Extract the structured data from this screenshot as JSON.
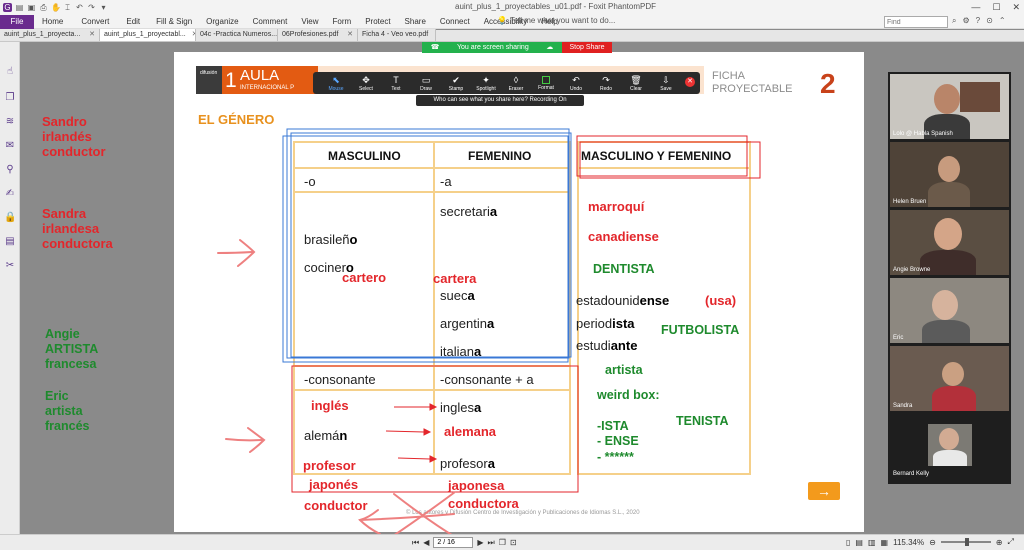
{
  "window": {
    "title": "auint_plus_1_proyectables_u01.pdf - Foxit PhantomPDF",
    "controls": [
      "—",
      "☐",
      "✕"
    ]
  },
  "menu": {
    "file": "File",
    "items": [
      "Home",
      "Convert",
      "Edit",
      "Fill & Sign",
      "Organize",
      "Comment",
      "View",
      "Form",
      "Protect",
      "Share",
      "Connect",
      "Accessibility",
      "Help"
    ],
    "tell_me": "Tell me what you want to do...",
    "find_placeholder": "Find"
  },
  "tabs": [
    {
      "label": "auint_plus_1_proyecta...",
      "active": false
    },
    {
      "label": "auint_plus_1_proyectabl...",
      "active": true
    },
    {
      "label": "04c -Practica Numeros...",
      "active": false
    },
    {
      "label": "06Profesiones.pdf",
      "active": false
    },
    {
      "label": "Ficha 4 - Veo veo.pdf",
      "active": false
    }
  ],
  "zoom": {
    "sharing": "You are screen sharing",
    "stop_share": "Stop Share",
    "tools": [
      {
        "icon": "⬉",
        "label": "Mouse"
      },
      {
        "icon": "✥",
        "label": "Select"
      },
      {
        "icon": "T",
        "label": "Text"
      },
      {
        "icon": "▭",
        "label": "Draw"
      },
      {
        "icon": "✔",
        "label": "Stamp"
      },
      {
        "icon": "✦",
        "label": "Spotlight"
      },
      {
        "icon": "◊",
        "label": "Eraser"
      },
      {
        "icon": "■",
        "label": "Format"
      },
      {
        "icon": "↶",
        "label": "Undo"
      },
      {
        "icon": "↷",
        "label": "Redo"
      },
      {
        "icon": "🗑",
        "label": "Clear"
      },
      {
        "icon": "⇩",
        "label": "Save"
      }
    ],
    "recording": "Who can see what you share here? Recording On"
  },
  "page": {
    "logo_number": "1",
    "logo_title": "AULA",
    "logo_subtitle": "INTERNACIONAL P",
    "logo_small": "difusión",
    "ficha_line1": "FICHA",
    "ficha_line2": "PROYECTABLE",
    "ficha_number": "2",
    "heading": "EL GÉNERO",
    "footer": "© Los autores y Difusión Centro de Investigación y Publicaciones de Idiomas S.L., 2020",
    "arrow": "→",
    "table": {
      "col_masc": "MASCULINO",
      "col_fem": "FEMENINO",
      "col_both": "MASCULINO Y FEMENINO",
      "end_masc": "-o",
      "end_fem": "-a",
      "masc_words": [
        {
          "stem": "brasileñ",
          "end": "o"
        },
        {
          "stem": "cociner",
          "end": "o"
        }
      ],
      "fem_words": [
        {
          "stem": "secretari",
          "end": "a"
        },
        {
          "stem": "suec",
          "end": "a"
        },
        {
          "stem": "argentin",
          "end": "a"
        },
        {
          "stem": "italian",
          "end": "a"
        }
      ],
      "cons_masc": "-consonante",
      "cons_fem": "-consonante + a",
      "cons_masc_word": {
        "stem": "alemá",
        "end": "n"
      },
      "cons_fem_words": [
        {
          "stem": "ingles",
          "end": "a"
        },
        {
          "stem": "profesor",
          "end": "a"
        }
      ],
      "both_words": [
        {
          "stem": "estadounid",
          "end": "ense"
        },
        {
          "stem": "period",
          "end": "ista"
        },
        {
          "stem": "estudi",
          "end": "ante"
        }
      ]
    }
  },
  "annotations": {
    "left_red": [
      {
        "lines": [
          "Sandro",
          "irlandés",
          "conductor"
        ]
      },
      {
        "lines": [
          "Sandra",
          "irlandesa",
          "conductora"
        ]
      }
    ],
    "left_green": [
      {
        "lines": [
          "Angie",
          "ARTISTA",
          "francesa"
        ]
      },
      {
        "lines": [
          "Eric",
          "artista",
          "francés"
        ]
      }
    ],
    "red_words": {
      "cartero": "cartero",
      "cartera": "cartera",
      "marroqui": "marroquí",
      "canadiense": "canadiense",
      "usa": "(usa)",
      "ingles": "inglés",
      "alemana": "alemana",
      "profesor": "profesor",
      "japones": "japonés",
      "japonesa": "japonesa",
      "conductor": "conductor",
      "conductora": "conductora"
    },
    "green_words": {
      "dentista": "DENTISTA",
      "futbolista": "FUTBOLISTA",
      "artista": "artista",
      "weird_box": "weird box:",
      "tenista": "TENISTA",
      "suffix1": "-ISTA",
      "suffix2": "- ENSE",
      "suffix3": "- ******"
    }
  },
  "participants": [
    {
      "name": "Lolo @ Habla Spanish"
    },
    {
      "name": "Helen Bruen"
    },
    {
      "name": "Angie Browne"
    },
    {
      "name": "Eric"
    },
    {
      "name": "Sandra"
    },
    {
      "name": "Bernard Kelly"
    }
  ],
  "status": {
    "page": "2 / 16",
    "zoom_level": "115.34%"
  },
  "colors": {
    "brand_purple": "#6a2b8e",
    "aula_orange": "#e35b12",
    "annotation_red": "#e3262b",
    "annotation_green": "#1e8a2d",
    "table_yellow": "#f5d08a"
  }
}
